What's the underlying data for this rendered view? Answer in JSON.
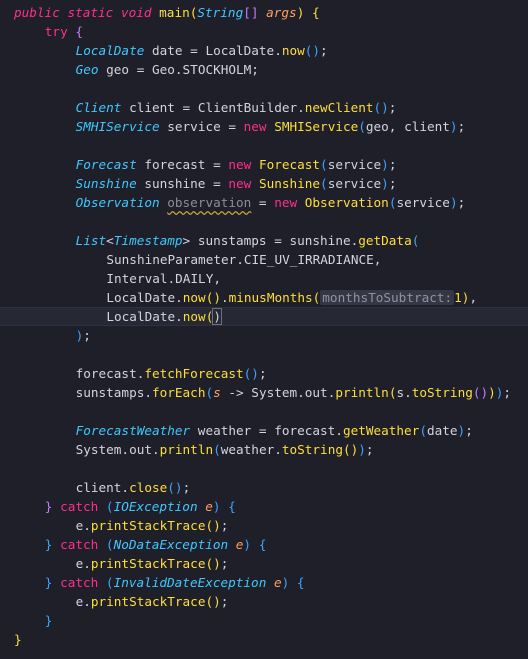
{
  "editor": {
    "background": "#1e1f28",
    "current_line_index": 16,
    "lines": [
      {
        "t": [
          [
            "kw",
            "public"
          ],
          [
            "var",
            " "
          ],
          [
            "kw",
            "static"
          ],
          [
            "var",
            " "
          ],
          [
            "kw",
            "void"
          ],
          [
            "var",
            " "
          ],
          [
            "fn",
            "main"
          ],
          [
            "br1",
            "("
          ],
          [
            "type",
            "String"
          ],
          [
            "br2",
            "[]"
          ],
          [
            "var",
            " "
          ],
          [
            "param",
            "args"
          ],
          [
            "br1",
            ")"
          ],
          [
            "var",
            " "
          ],
          [
            "br1",
            "{"
          ]
        ],
        "indent": 0
      },
      {
        "t": [
          [
            "kw2",
            "try"
          ],
          [
            "var",
            " "
          ],
          [
            "br2",
            "{"
          ]
        ],
        "indent": 1
      },
      {
        "t": [
          [
            "type",
            "LocalDate"
          ],
          [
            "var",
            " date = LocalDate."
          ],
          [
            "fn",
            "now"
          ],
          [
            "br3",
            "()"
          ],
          [
            "var",
            ";"
          ]
        ],
        "indent": 2
      },
      {
        "t": [
          [
            "type",
            "Geo"
          ],
          [
            "var",
            " geo = Geo.STOCKHOLM;"
          ]
        ],
        "indent": 2
      },
      {
        "t": [],
        "indent": 2
      },
      {
        "t": [
          [
            "type",
            "Client"
          ],
          [
            "var",
            " client = ClientBuilder."
          ],
          [
            "fn",
            "newClient"
          ],
          [
            "br3",
            "()"
          ],
          [
            "var",
            ";"
          ]
        ],
        "indent": 2
      },
      {
        "t": [
          [
            "type",
            "SMHIService"
          ],
          [
            "var",
            " service = "
          ],
          [
            "kw2",
            "new"
          ],
          [
            "var",
            " "
          ],
          [
            "cls",
            "SMHIService"
          ],
          [
            "br3",
            "("
          ],
          [
            "var",
            "geo, client"
          ],
          [
            "br3",
            ")"
          ],
          [
            "var",
            ";"
          ]
        ],
        "indent": 2
      },
      {
        "t": [],
        "indent": 2
      },
      {
        "t": [
          [
            "type",
            "Forecast"
          ],
          [
            "var",
            " forecast = "
          ],
          [
            "kw2",
            "new"
          ],
          [
            "var",
            " "
          ],
          [
            "cls",
            "Forecast"
          ],
          [
            "br3",
            "("
          ],
          [
            "var",
            "service"
          ],
          [
            "br3",
            ")"
          ],
          [
            "var",
            ";"
          ]
        ],
        "indent": 2
      },
      {
        "t": [
          [
            "type",
            "Sunshine"
          ],
          [
            "var",
            " sunshine = "
          ],
          [
            "kw2",
            "new"
          ],
          [
            "var",
            " "
          ],
          [
            "cls",
            "Sunshine"
          ],
          [
            "br3",
            "("
          ],
          [
            "var",
            "service"
          ],
          [
            "br3",
            ")"
          ],
          [
            "var",
            ";"
          ]
        ],
        "indent": 2
      },
      {
        "t": [
          [
            "type",
            "Observation"
          ],
          [
            "var",
            " "
          ],
          [
            "dim",
            "observation"
          ],
          [
            "var",
            " = "
          ],
          [
            "kw2",
            "new"
          ],
          [
            "var",
            " "
          ],
          [
            "cls",
            "Observation"
          ],
          [
            "br3",
            "("
          ],
          [
            "var",
            "service"
          ],
          [
            "br3",
            ")"
          ],
          [
            "var",
            ";"
          ]
        ],
        "indent": 2
      },
      {
        "t": [],
        "indent": 2
      },
      {
        "t": [
          [
            "type",
            "List"
          ],
          [
            "var",
            "<"
          ],
          [
            "type",
            "Timestamp"
          ],
          [
            "var",
            "> sunstamps = sunshine."
          ],
          [
            "fn",
            "getData"
          ],
          [
            "br3",
            "("
          ]
        ],
        "indent": 2
      },
      {
        "t": [
          [
            "var",
            "SunshineParameter.CIE_UV_IRRADIANCE,"
          ]
        ],
        "indent": 3
      },
      {
        "t": [
          [
            "var",
            "Interval.DAILY,"
          ]
        ],
        "indent": 3
      },
      {
        "t": [
          [
            "var",
            "LocalDate."
          ],
          [
            "fn",
            "now"
          ],
          [
            "br1",
            "()"
          ],
          [
            "var",
            "."
          ],
          [
            "fn",
            "minusMonths"
          ],
          [
            "br1",
            "("
          ],
          [
            "hint",
            "monthsToSubtract:"
          ],
          [
            "num",
            "1"
          ],
          [
            "br1",
            ")"
          ],
          [
            "var",
            ","
          ]
        ],
        "indent": 3
      },
      {
        "t": [
          [
            "var",
            "LocalDate."
          ],
          [
            "fn",
            "now"
          ],
          [
            "br1",
            "("
          ],
          [
            "matchbr",
            ")"
          ]
        ],
        "indent": 3
      },
      {
        "t": [
          [
            "br3",
            ")"
          ],
          [
            "var",
            ";"
          ]
        ],
        "indent": 2
      },
      {
        "t": [],
        "indent": 2
      },
      {
        "t": [
          [
            "var",
            "forecast."
          ],
          [
            "fn",
            "fetchForecast"
          ],
          [
            "br3",
            "()"
          ],
          [
            "var",
            ";"
          ]
        ],
        "indent": 2
      },
      {
        "t": [
          [
            "var",
            "sunstamps."
          ],
          [
            "fn",
            "forEach"
          ],
          [
            "br3",
            "("
          ],
          [
            "param",
            "s"
          ],
          [
            "var",
            " -> System.out."
          ],
          [
            "fn",
            "println"
          ],
          [
            "br1",
            "("
          ],
          [
            "var",
            "s."
          ],
          [
            "fn",
            "toString"
          ],
          [
            "br2",
            "()"
          ],
          [
            "br1",
            ")"
          ],
          [
            "br3",
            ")"
          ],
          [
            "var",
            ";"
          ]
        ],
        "indent": 2
      },
      {
        "t": [],
        "indent": 2
      },
      {
        "t": [
          [
            "type",
            "ForecastWeather"
          ],
          [
            "var",
            " weather = forecast."
          ],
          [
            "fn",
            "getWeather"
          ],
          [
            "br3",
            "("
          ],
          [
            "var",
            "date"
          ],
          [
            "br3",
            ")"
          ],
          [
            "var",
            ";"
          ]
        ],
        "indent": 2
      },
      {
        "t": [
          [
            "var",
            "System.out."
          ],
          [
            "fn",
            "println"
          ],
          [
            "br3",
            "("
          ],
          [
            "var",
            "weather."
          ],
          [
            "fn",
            "toString"
          ],
          [
            "br1",
            "()"
          ],
          [
            "br3",
            ")"
          ],
          [
            "var",
            ";"
          ]
        ],
        "indent": 2
      },
      {
        "t": [],
        "indent": 2
      },
      {
        "t": [
          [
            "var",
            "client."
          ],
          [
            "fn",
            "close"
          ],
          [
            "br3",
            "()"
          ],
          [
            "var",
            ";"
          ]
        ],
        "indent": 2
      },
      {
        "t": [
          [
            "br2",
            "}"
          ],
          [
            "var",
            " "
          ],
          [
            "kw2",
            "catch"
          ],
          [
            "var",
            " "
          ],
          [
            "br3",
            "("
          ],
          [
            "type",
            "IOException"
          ],
          [
            "var",
            " "
          ],
          [
            "param",
            "e"
          ],
          [
            "br3",
            ")"
          ],
          [
            "var",
            " "
          ],
          [
            "br3",
            "{"
          ]
        ],
        "indent": 1
      },
      {
        "t": [
          [
            "var",
            "e."
          ],
          [
            "fn",
            "printStackTrace"
          ],
          [
            "br1",
            "()"
          ],
          [
            "var",
            ";"
          ]
        ],
        "indent": 2
      },
      {
        "t": [
          [
            "br3",
            "}"
          ],
          [
            "var",
            " "
          ],
          [
            "kw2",
            "catch"
          ],
          [
            "var",
            " "
          ],
          [
            "br3",
            "("
          ],
          [
            "type",
            "NoDataException"
          ],
          [
            "var",
            " "
          ],
          [
            "param",
            "e"
          ],
          [
            "br3",
            ")"
          ],
          [
            "var",
            " "
          ],
          [
            "br3",
            "{"
          ]
        ],
        "indent": 1
      },
      {
        "t": [
          [
            "var",
            "e."
          ],
          [
            "fn",
            "printStackTrace"
          ],
          [
            "br1",
            "()"
          ],
          [
            "var",
            ";"
          ]
        ],
        "indent": 2
      },
      {
        "t": [
          [
            "br3",
            "}"
          ],
          [
            "var",
            " "
          ],
          [
            "kw2",
            "catch"
          ],
          [
            "var",
            " "
          ],
          [
            "br3",
            "("
          ],
          [
            "type",
            "InvalidDateException"
          ],
          [
            "var",
            " "
          ],
          [
            "param",
            "e"
          ],
          [
            "br3",
            ")"
          ],
          [
            "var",
            " "
          ],
          [
            "br3",
            "{"
          ]
        ],
        "indent": 1
      },
      {
        "t": [
          [
            "var",
            "e."
          ],
          [
            "fn",
            "printStackTrace"
          ],
          [
            "br1",
            "()"
          ],
          [
            "var",
            ";"
          ]
        ],
        "indent": 2
      },
      {
        "t": [
          [
            "br3",
            "}"
          ]
        ],
        "indent": 1
      },
      {
        "t": [
          [
            "br1",
            "}"
          ]
        ],
        "indent": 0
      }
    ]
  }
}
